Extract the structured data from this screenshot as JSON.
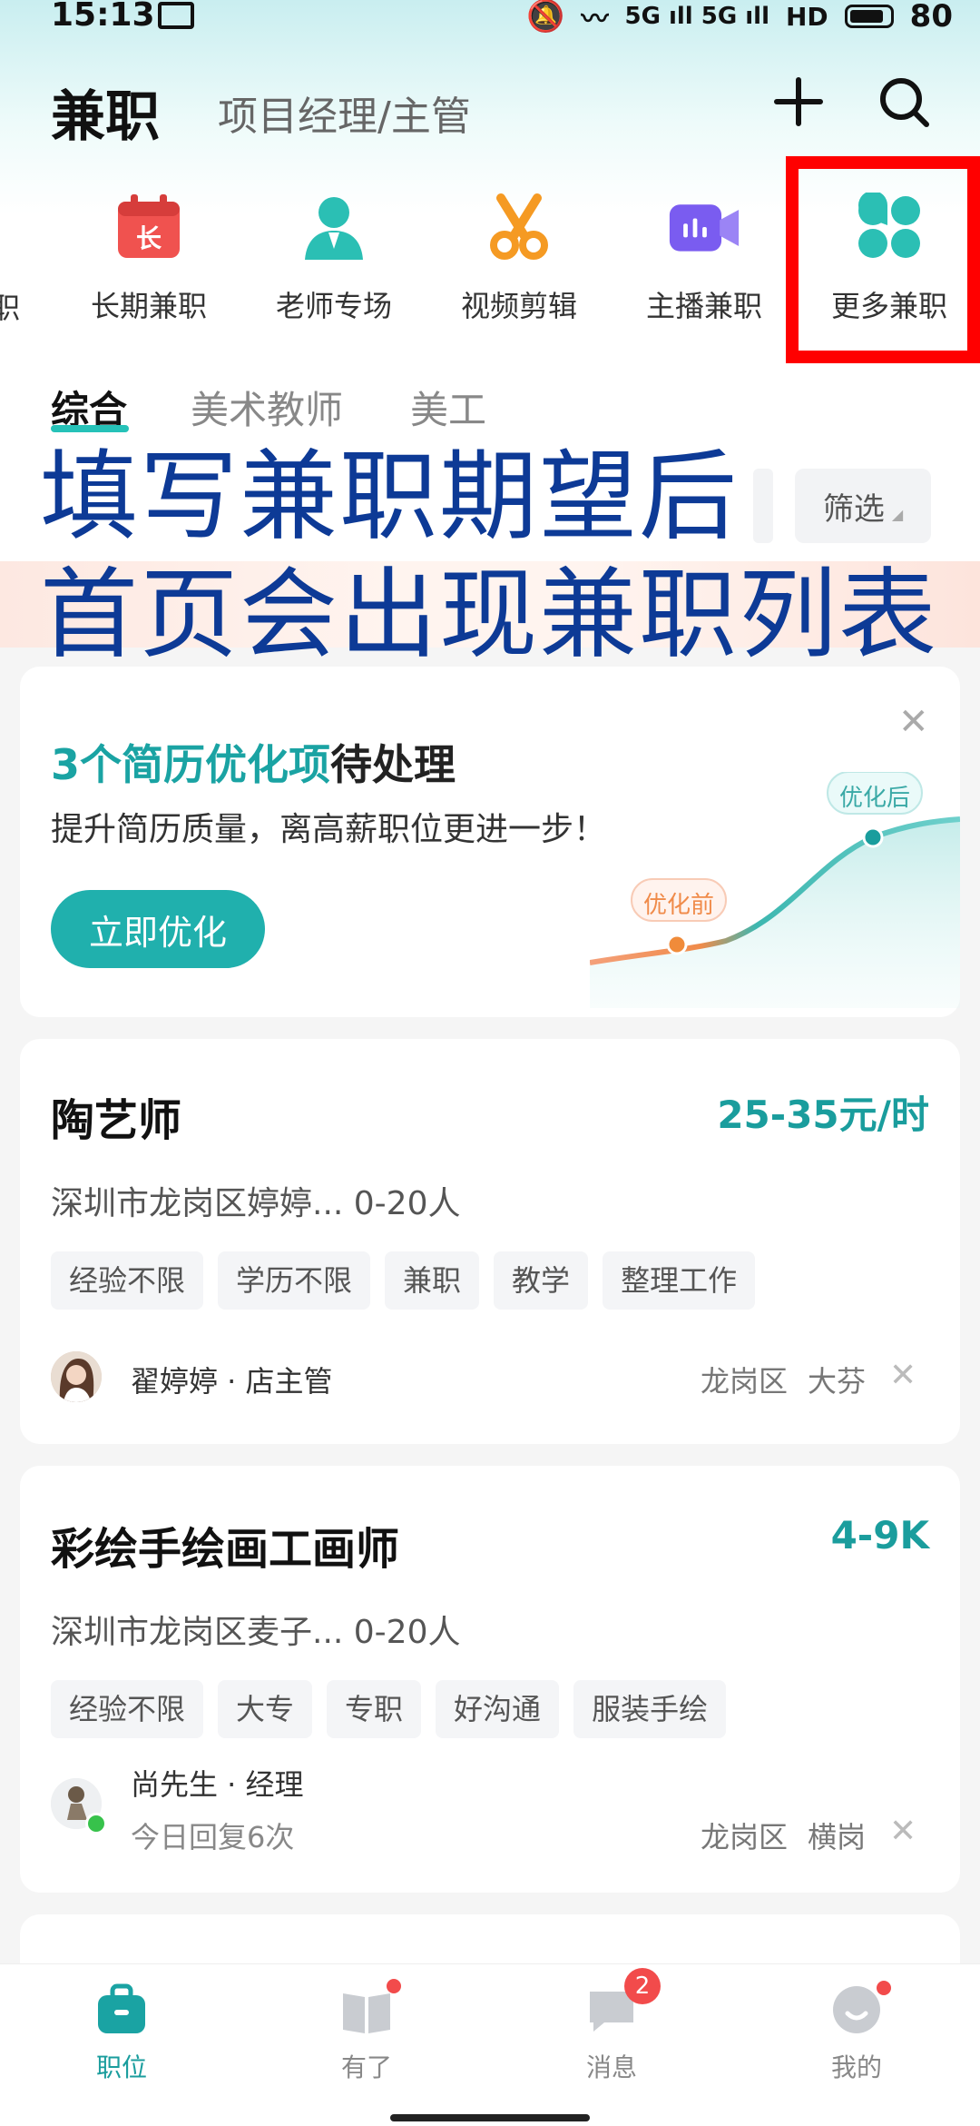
{
  "status_bar": {
    "time": "15:13",
    "signal": "5G ıll 5G ıll",
    "hd": "HD",
    "battery": "80"
  },
  "header": {
    "title": "兼职",
    "subtitle": "项目经理/主管"
  },
  "categories": [
    {
      "label": "职",
      "icon": "partial-icon"
    },
    {
      "label": "长期兼职",
      "icon": "calendar-icon",
      "glyph": "长",
      "color": "#f0524f"
    },
    {
      "label": "老师专场",
      "icon": "teacher-icon",
      "color": "#2bbfb4"
    },
    {
      "label": "视频剪辑",
      "icon": "scissors-icon",
      "color": "#f59a23"
    },
    {
      "label": "主播兼职",
      "icon": "video-camera-icon",
      "color": "#7a5cf0"
    },
    {
      "label": "更多兼职",
      "icon": "clover-icon",
      "color": "#2bbfb4"
    }
  ],
  "tabs": [
    "综合",
    "美术教师",
    "美工"
  ],
  "filter": {
    "label": "筛选"
  },
  "overlay": {
    "line1": "填写兼职期望后",
    "line2": "首页会出现兼职列表"
  },
  "promo": {
    "title_highlight": "3个简历优化项",
    "title_rest": "待处理",
    "desc": "提升简历质量，离高薪职位更进一步！",
    "button": "立即优化",
    "before_label": "优化前",
    "after_label": "优化后"
  },
  "jobs": [
    {
      "title": "陶艺师",
      "salary": "25-35元/时",
      "location": "深圳市龙岗区婷婷... 0-20人",
      "tags": [
        "经验不限",
        "学历不限",
        "兼职",
        "教学",
        "整理工作"
      ],
      "recruiter": "翟婷婷 · 店主管",
      "area": "龙岗区",
      "subarea": "大芬"
    },
    {
      "title": "彩绘手绘画工画师",
      "salary": "4-9K",
      "location": "深圳市龙岗区麦子... 0-20人",
      "tags": [
        "经验不限",
        "大专",
        "专职",
        "好沟通",
        "服装手绘"
      ],
      "recruiter": "尚先生 · 经理",
      "recruiter_sub": "今日回复6次",
      "area": "龙岗区",
      "subarea": "横岗"
    }
  ],
  "nav": [
    {
      "label": "职位",
      "icon": "briefcase-icon"
    },
    {
      "label": "有了",
      "icon": "book-icon"
    },
    {
      "label": "消息",
      "icon": "chat-icon",
      "badge": "2"
    },
    {
      "label": "我的",
      "icon": "profile-icon"
    }
  ],
  "colors": {
    "accent": "#1a9d9d",
    "highlight_box": "#ff0000",
    "overlay_text": "#0d3a96"
  }
}
